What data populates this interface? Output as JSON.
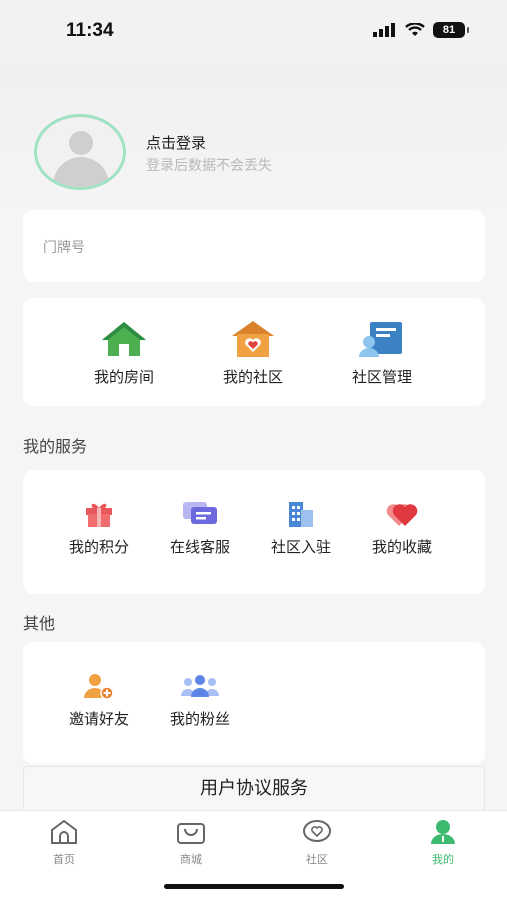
{
  "status_bar": {
    "time": "11:34",
    "battery": "81"
  },
  "profile": {
    "login_title": "点击登录",
    "login_subtitle": "登录后数据不会丢失"
  },
  "door": {
    "placeholder": "门牌号"
  },
  "rooms": {
    "items": [
      {
        "label": "我的房间",
        "icon": "house-icon"
      },
      {
        "label": "我的社区",
        "icon": "community-heart-icon"
      },
      {
        "label": "社区管理",
        "icon": "management-icon"
      }
    ]
  },
  "services": {
    "title": "我的服务",
    "items": [
      {
        "label": "我的积分",
        "icon": "gift-icon"
      },
      {
        "label": "在线客服",
        "icon": "chat-icon"
      },
      {
        "label": "社区入驻",
        "icon": "building-icon"
      },
      {
        "label": "我的收藏",
        "icon": "heart-icon"
      }
    ]
  },
  "others": {
    "title": "其他",
    "items": [
      {
        "label": "邀请好友",
        "icon": "invite-user-icon"
      },
      {
        "label": "我的粉丝",
        "icon": "fans-icon"
      }
    ]
  },
  "agreement": {
    "label": "用户协议服务"
  },
  "tabbar": {
    "tabs": [
      {
        "label": "首页",
        "icon": "home-tab-icon"
      },
      {
        "label": "商城",
        "icon": "shop-bag-icon"
      },
      {
        "label": "社区",
        "icon": "community-tab-icon"
      },
      {
        "label": "我的",
        "icon": "profile-tab-icon",
        "active": true
      }
    ]
  },
  "colors": {
    "accent": "#3cba6f",
    "avatar_ring": "#9fe2c4"
  }
}
